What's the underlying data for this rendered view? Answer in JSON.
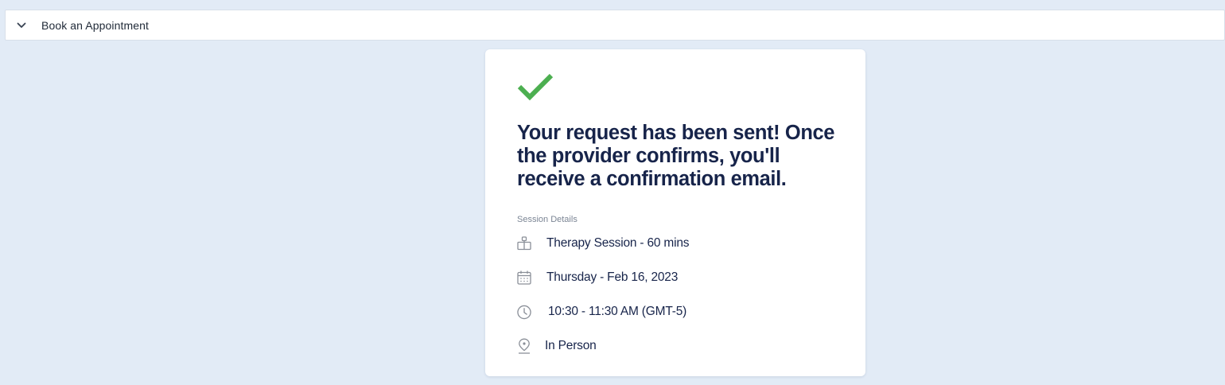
{
  "header": {
    "title": "Book an Appointment",
    "toggle_icon": "chevron-down-icon"
  },
  "confirmation": {
    "status_icon": "checkmark-icon",
    "status_color": "#4caf50",
    "message": "Your request has been sent! Once the provider confirms, you'll receive a confirmation email.",
    "section_label": "Session Details",
    "details": {
      "service": {
        "icon": "service-icon",
        "text": "Therapy Session - 60 mins"
      },
      "date": {
        "icon": "calendar-icon",
        "text": "Thursday - Feb 16, 2023"
      },
      "time": {
        "icon": "clock-icon",
        "text": "10:30 - 11:30 AM (GMT-5)"
      },
      "location": {
        "icon": "location-pin-icon",
        "text": "In Person"
      }
    }
  },
  "colors": {
    "background": "#e2ebf6",
    "heading": "#17244a",
    "icon_gray": "#8a8f98"
  }
}
